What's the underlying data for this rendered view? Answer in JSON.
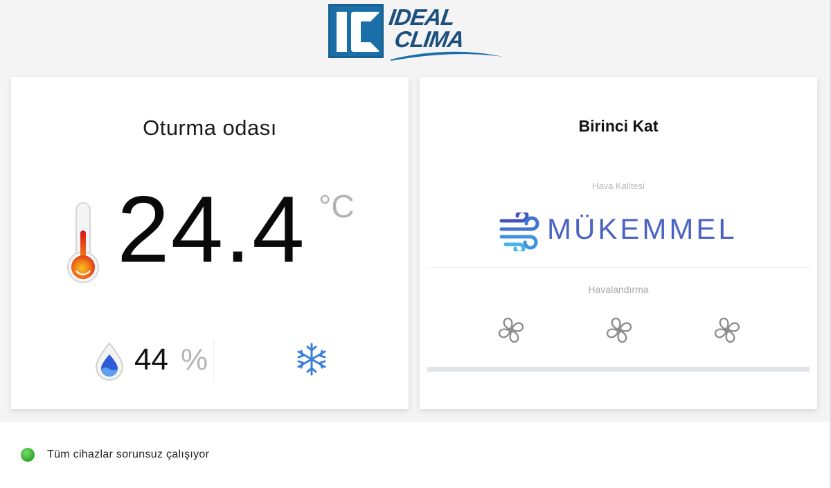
{
  "brand": {
    "logo_mark": "IC",
    "logo_line1": "IDEAL",
    "logo_line2": "CLIMA",
    "color": "#1b6fa8"
  },
  "room_card": {
    "title": "Oturma odası",
    "temperature": "24.4",
    "temperature_unit": "°C",
    "humidity": "44",
    "humidity_unit": "%",
    "mode_icon": "snowflake-icon"
  },
  "floor_card": {
    "title": "Birinci Kat",
    "air_quality_label": "Hava Kalitesi",
    "air_quality_value": "MÜKEMMEL",
    "air_quality_icon": "wind-icon",
    "ventilation_label": "Havalandırma",
    "fans": [
      "fan-icon",
      "fan-icon",
      "fan-icon"
    ],
    "accent": "#4b63c4"
  },
  "footer": {
    "status_text": "Tüm cihazlar sorunsuz çalışıyor",
    "status_color": "#2ea82b"
  }
}
